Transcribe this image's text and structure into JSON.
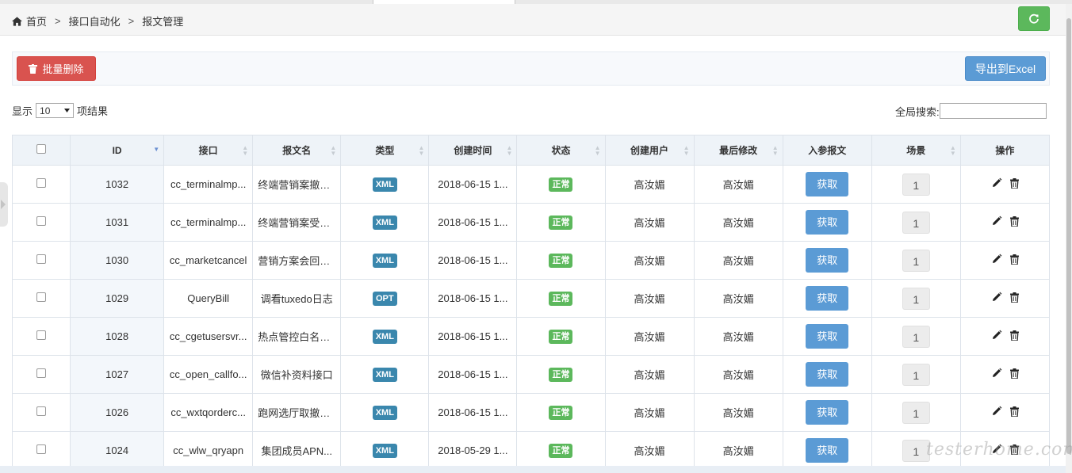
{
  "breadcrumb": {
    "home": "首页",
    "sep": ">",
    "level2": "接口自动化",
    "level3": "报文管理"
  },
  "toolbar": {
    "delete_label": "批量删除",
    "export_label": "导出到Excel"
  },
  "length": {
    "prefix": "显示",
    "value": "10",
    "suffix": "项结果"
  },
  "search": {
    "label": "全局搜索:",
    "value": ""
  },
  "table": {
    "columns": [
      "",
      "ID",
      "接口",
      "报文名",
      "类型",
      "创建时间",
      "状态",
      "创建用户",
      "最后修改",
      "入参报文",
      "场景",
      "操作"
    ],
    "fetch_label": "获取",
    "rows": [
      {
        "id": "1032",
        "interface": "cc_terminalmp...",
        "name": "终端营销案撤销...",
        "type": "XML",
        "created": "2018-06-15 1...",
        "status": "正常",
        "creator": "高汝媚",
        "modifier": "高汝媚",
        "scene": "1"
      },
      {
        "id": "1031",
        "interface": "cc_terminalmp...",
        "name": "终端营销案受理...",
        "type": "XML",
        "created": "2018-06-15 1...",
        "status": "正常",
        "creator": "高汝媚",
        "modifier": "高汝媚",
        "scene": "1"
      },
      {
        "id": "1030",
        "interface": "cc_marketcancel",
        "name": "营销方案会回退...",
        "type": "XML",
        "created": "2018-06-15 1...",
        "status": "正常",
        "creator": "高汝媚",
        "modifier": "高汝媚",
        "scene": "1"
      },
      {
        "id": "1029",
        "interface": "QueryBill",
        "name": "调看tuxedo日志",
        "type": "OPT",
        "created": "2018-06-15 1...",
        "status": "正常",
        "creator": "高汝媚",
        "modifier": "高汝媚",
        "scene": "1"
      },
      {
        "id": "1028",
        "interface": "cc_cgetusersvr...",
        "name": "热点管控白名单...",
        "type": "XML",
        "created": "2018-06-15 1...",
        "status": "正常",
        "creator": "高汝媚",
        "modifier": "高汝媚",
        "scene": "1"
      },
      {
        "id": "1027",
        "interface": "cc_open_callfo...",
        "name": "微信补资料接口",
        "type": "XML",
        "created": "2018-06-15 1...",
        "status": "正常",
        "creator": "高汝媚",
        "modifier": "高汝媚",
        "scene": "1"
      },
      {
        "id": "1026",
        "interface": "cc_wxtqorderc...",
        "name": "跑网选厅取撤单...",
        "type": "XML",
        "created": "2018-06-15 1...",
        "status": "正常",
        "creator": "高汝媚",
        "modifier": "高汝媚",
        "scene": "1"
      },
      {
        "id": "1024",
        "interface": "cc_wlw_qryapn",
        "name": "集团成员APN...",
        "type": "XML",
        "created": "2018-05-29 1...",
        "status": "正常",
        "creator": "高汝媚",
        "modifier": "高汝媚",
        "scene": "1"
      }
    ]
  },
  "watermark": "testerhome.com",
  "colors": {
    "success": "#5cb85c",
    "danger": "#d9534f",
    "primary": "#5b9bd5",
    "type_badge": "#3a87ad"
  },
  "icons": [
    "home-icon",
    "refresh-icon",
    "trash-icon",
    "sort-icon",
    "edit-icon",
    "chevron-down-icon"
  ]
}
